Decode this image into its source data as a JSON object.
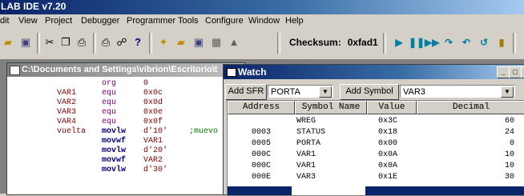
{
  "app": {
    "title": "LAB IDE v7.20"
  },
  "menu": [
    "dit",
    "View",
    "Project",
    "Debugger",
    "Programmer",
    "Tools",
    "Configure",
    "Window",
    "Help"
  ],
  "toolbar": {
    "checksum_label": "Checksum:",
    "checksum_value": "0xfad1",
    "icons": [
      "open-icon",
      "save-icon",
      "cut-icon",
      "copy-icon",
      "paste-icon",
      "print-icon",
      "find-icon",
      "help-icon",
      "new-project-icon",
      "open-project-icon",
      "save-project-icon",
      "build-icon",
      "make-icon"
    ],
    "debug_icons": [
      "run-icon",
      "halt-icon",
      "animate-icon",
      "step-into-icon",
      "step-over-icon",
      "step-out-icon"
    ]
  },
  "source_window": {
    "title": "C:\\Documents and Settings\\vibrion\\Escritorio\\t",
    "lines": [
      {
        "label": "",
        "mnemonic": "org",
        "operand": "0",
        "comment": "",
        "bold": false
      },
      {
        "label": "VAR1",
        "mnemonic": "equ",
        "operand": "0x0c",
        "comment": "",
        "bold": false
      },
      {
        "label": "VAR2",
        "mnemonic": "equ",
        "operand": "0x0d",
        "comment": "",
        "bold": false
      },
      {
        "label": "VAR3",
        "mnemonic": "equ",
        "operand": "0x0e",
        "comment": "",
        "bold": false
      },
      {
        "label": "VAR4",
        "mnemonic": "equ",
        "operand": "0x0f",
        "comment": "",
        "bold": false
      },
      {
        "label": "vuelta",
        "mnemonic": "movlw",
        "operand": "d'10'",
        "comment": ";muevo l",
        "bold": true
      },
      {
        "label": "",
        "mnemonic": "movwf",
        "operand": "VAR1",
        "comment": "",
        "bold": true
      },
      {
        "label": "",
        "mnemonic": "movlw",
        "operand": "d'20'",
        "comment": "",
        "bold": true
      },
      {
        "label": "",
        "mnemonic": "movwf",
        "operand": "VAR2",
        "comment": "",
        "bold": true
      },
      {
        "label": "",
        "mnemonic": "movlw",
        "operand": "d'30'",
        "comment": "",
        "bold": true
      }
    ]
  },
  "watch": {
    "title": "Watch",
    "add_sfr_label": "Add SFR",
    "sfr_selected": "PORTA",
    "add_symbol_label": "Add Symbol",
    "symbol_selected": "VAR3",
    "columns": [
      "Address",
      "Symbol Name",
      "Value",
      "Decimal"
    ],
    "rows": [
      {
        "address": "",
        "symbol": "WREG",
        "value": "0x3C",
        "decimal": "60"
      },
      {
        "address": "0003",
        "symbol": "STATUS",
        "value": "0x18",
        "decimal": "24"
      },
      {
        "address": "0005",
        "symbol": "PORTA",
        "value": "0x00",
        "decimal": "0"
      },
      {
        "address": "000C",
        "symbol": "VAR1",
        "value": "0x0A",
        "decimal": "10"
      },
      {
        "address": "000C",
        "symbol": "VAR1",
        "value": "0x0A",
        "decimal": "10"
      },
      {
        "address": "000E",
        "symbol": "VAR3",
        "value": "0x1E",
        "decimal": "30"
      }
    ]
  }
}
